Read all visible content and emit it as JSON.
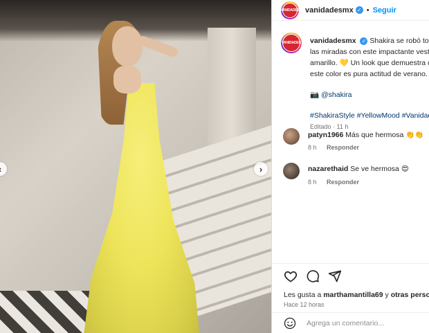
{
  "post": {
    "username": "vanidadesmx",
    "avatar_text": "VANIDADES",
    "follow_label": "Seguir",
    "separator": "•",
    "verified_glyph": "✓"
  },
  "photo": {
    "prev_glyph": "‹",
    "next_glyph": "›"
  },
  "caption": {
    "username": "vanidadesmx",
    "text": "Shakira se robó todas las miradas con este impactante vestido amarillo. 💛 Un look que demuestra que este color es pura actitud de verano.",
    "camera_emoji": "📷",
    "mention": "@shakira",
    "hashtags": "#ShakiraStyle #YellowMood #VanidadesMx",
    "edited": "Editado · 11 h"
  },
  "comments": [
    {
      "username": "patyn1966",
      "text": "Más que hermosa 👏👏",
      "time": "8 h",
      "reply": "Responder"
    },
    {
      "username": "nazarethaid",
      "text": "Se ve hermosa 😍",
      "time": "8 h",
      "reply": "Responder"
    }
  ],
  "actions": {
    "likes_prefix": "Les gusta a ",
    "likes_user": "marthamantilla69",
    "likes_middle": " y ",
    "likes_others": "otras personas",
    "time_ago": "Hace 12 horas",
    "comment_placeholder": "Agrega un comentario..."
  },
  "icons": [
    "heart-icon",
    "comment-icon",
    "share-icon",
    "emoji-icon",
    "verified-icon"
  ],
  "colors": {
    "accent": "#0095f6",
    "brand_red": "#d7262f",
    "dress_yellow": "#eee45a"
  }
}
